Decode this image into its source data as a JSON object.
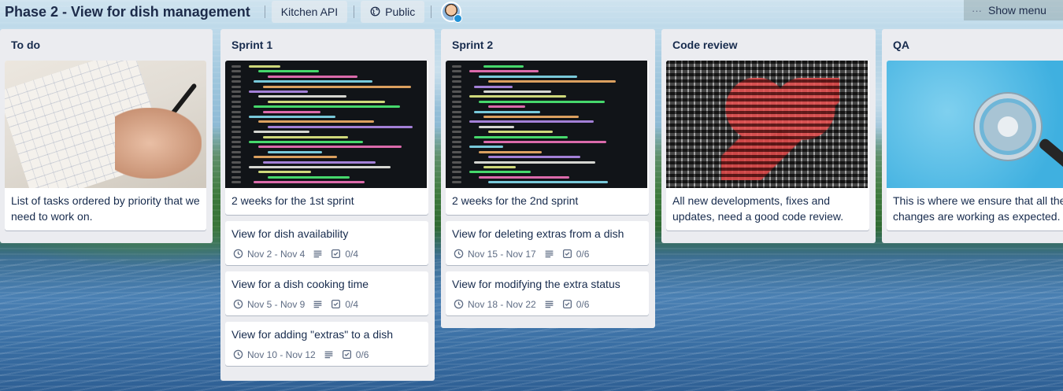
{
  "header": {
    "board_title": "Phase 2 - View for dish management",
    "team_button": "Kitchen API",
    "visibility_button": "Public",
    "show_menu": "Show menu"
  },
  "lists": [
    {
      "title": "To do",
      "cards": [
        {
          "text": "List of tasks ordered by priority that we need to work on.",
          "cover": "notebook-photo"
        }
      ]
    },
    {
      "title": "Sprint 1",
      "cards": [
        {
          "text": "2 weeks for the 1st sprint",
          "cover": "code-photo"
        },
        {
          "text": "View for dish availability",
          "dates": "Nov 2 - Nov 4",
          "checklist": "0/4"
        },
        {
          "text": "View for a dish cooking time",
          "dates": "Nov 5 - Nov 9",
          "checklist": "0/4"
        },
        {
          "text": "View for adding \"extras\" to a dish",
          "dates": "Nov 10 - Nov 12",
          "checklist": "0/6"
        }
      ]
    },
    {
      "title": "Sprint 2",
      "cards": [
        {
          "text": "2 weeks for the 2nd sprint",
          "cover": "code-photo"
        },
        {
          "text": "View for deleting extras from a dish",
          "dates": "Nov 15 - Nov 17",
          "checklist": "0/6"
        },
        {
          "text": "View for modifying the extra status",
          "dates": "Nov 18 - Nov 22",
          "checklist": "0/6"
        }
      ]
    },
    {
      "title": "Code review",
      "cards": [
        {
          "text": "All new developments, fixes and updates, need a good code review.",
          "cover": "binary-heart-photo"
        }
      ]
    },
    {
      "title": "QA",
      "cards": [
        {
          "text": "This is where we ensure that all the changes are working as expected.",
          "cover": "magnifier-photo"
        }
      ]
    }
  ],
  "icons": {
    "clock": "clock-icon",
    "description": "description-icon",
    "checklist": "checklist-icon",
    "globe": "globe-icon",
    "more": "more-icon"
  },
  "colors": {
    "list_bg": "#ebecf0",
    "card_bg": "#ffffff",
    "text": "#172b4d",
    "muted": "#5e6c84"
  }
}
